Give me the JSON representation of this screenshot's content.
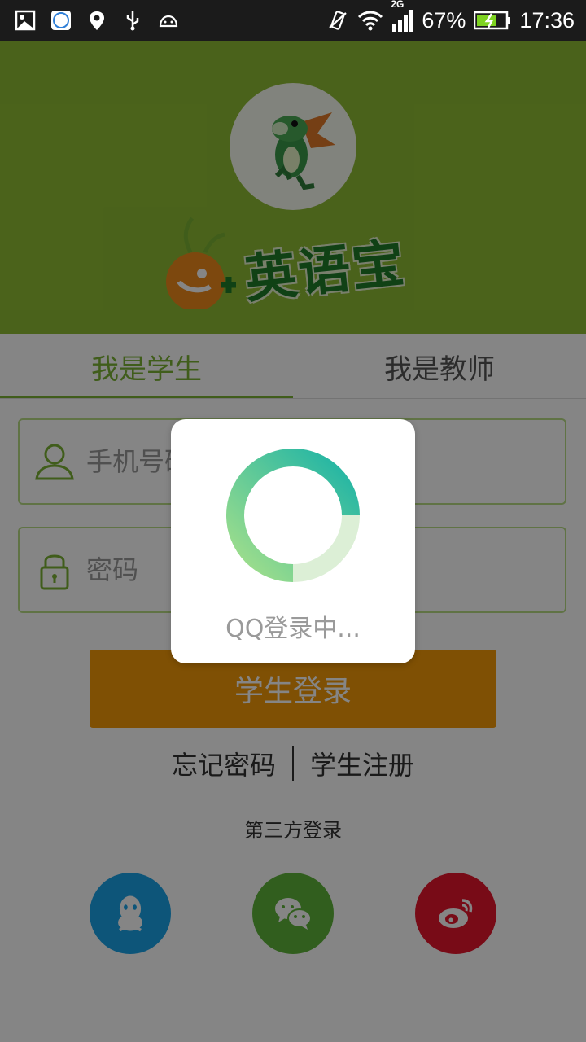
{
  "status_bar": {
    "battery_percent": "67%",
    "time": "17:36",
    "network_type": "2G",
    "left_icons": [
      "image-icon",
      "ifly-icon",
      "location-icon",
      "usb-icon",
      "android-icon"
    ],
    "right_icons": [
      "vibrate-icon",
      "wifi-icon",
      "signal-icon",
      "battery-charging-icon"
    ]
  },
  "header": {
    "logo_text": "英语宝",
    "logo_mark": "e+",
    "background_color": "#8fbd34"
  },
  "tabs": [
    {
      "label": "我是学生",
      "active": true
    },
    {
      "label": "我是教师",
      "active": false
    }
  ],
  "form": {
    "phone_placeholder": "手机号码",
    "password_placeholder": "密码",
    "login_button": "学生登录",
    "forgot_password": "忘记密码",
    "register": "学生注册"
  },
  "third_party": {
    "title": "第三方登录",
    "providers": [
      {
        "name": "qq",
        "color": "#1aa3e8"
      },
      {
        "name": "wechat",
        "color": "#5fb53a"
      },
      {
        "name": "weibo",
        "color": "#e6162d"
      }
    ]
  },
  "dialog": {
    "message": "QQ登录中..."
  },
  "colors": {
    "accent": "#7cb335",
    "button": "#f39a08"
  }
}
